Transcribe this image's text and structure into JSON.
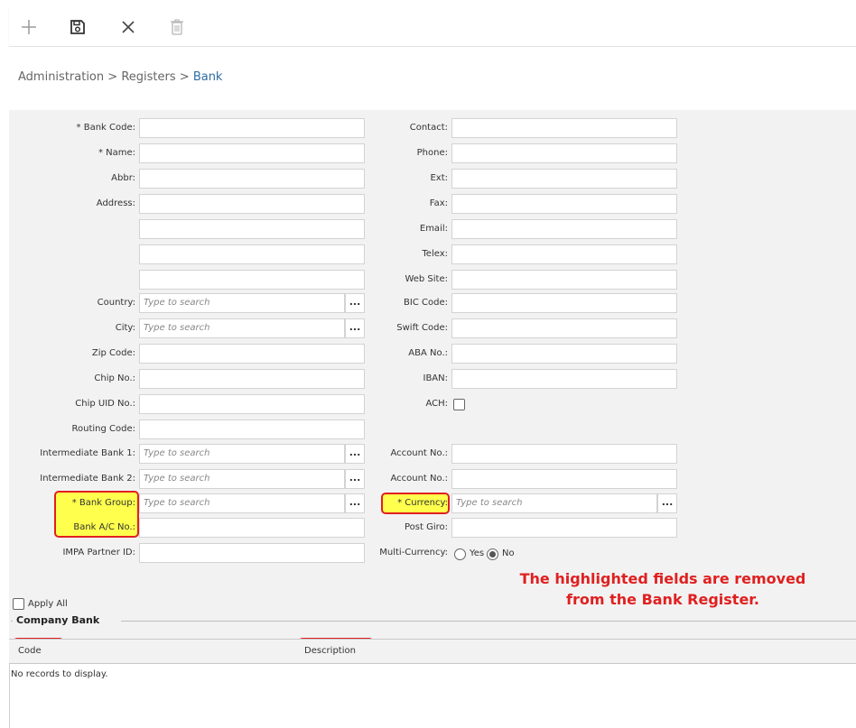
{
  "toolbar": {
    "icons": [
      "plus-icon",
      "save-icon",
      "close-icon",
      "trash-icon"
    ]
  },
  "breadcrumb": {
    "part1": "Administration",
    "sep": ">",
    "part2": "Registers",
    "current": "Bank"
  },
  "form": {
    "bank_code_label": "* Bank Code:",
    "name_label": "* Name:",
    "abbr_label": "Abbr:",
    "address_label": "Address:",
    "country_label": "Country:",
    "city_label": "City:",
    "zip_label": "Zip Code:",
    "chip_label": "Chip No.:",
    "chip_uid_label": "Chip UID No.:",
    "routing_label": "Routing Code:",
    "intermediate1_label": "Intermediate Bank 1:",
    "intermediate2_label": "Intermediate Bank 2:",
    "bank_group_label": "* Bank Group:",
    "bank_ac_label": "Bank A/C No.:",
    "impa_label": "IMPA Partner ID:",
    "contact_label": "Contact:",
    "phone_label": "Phone:",
    "ext_label": "Ext:",
    "fax_label": "Fax:",
    "email_label": "Email:",
    "telex_label": "Telex:",
    "website_label": "Web Site:",
    "bic_label": "BIC Code:",
    "swift_label": "Swift Code:",
    "aba_label": "ABA No.:",
    "iban_label": "IBAN:",
    "ach_label": "ACH:",
    "account1_label": "Account No.:",
    "account2_label": "Account No.:",
    "currency_label": "* Currency:",
    "post_giro_label": "Post Giro:",
    "multi_currency_label": "Multi-Currency:",
    "yes_label": "Yes",
    "no_label": "No",
    "multi_currency_value": "No",
    "search_placeholder": "Type to search",
    "ellipsis": "..."
  },
  "annotation": {
    "line1": "The highlighted fields are removed",
    "line2": "from the Bank Register."
  },
  "apply_all_label": "Apply All",
  "company_bank": {
    "title": "Company Bank",
    "columns": [
      "Code",
      "Description"
    ],
    "empty": "No records to display."
  },
  "colors": {
    "highlight_fill": "#ffff4d",
    "highlight_border": "#e02020",
    "annotation_text": "#e02020",
    "breadcrumb_current": "#2d6ca2"
  }
}
